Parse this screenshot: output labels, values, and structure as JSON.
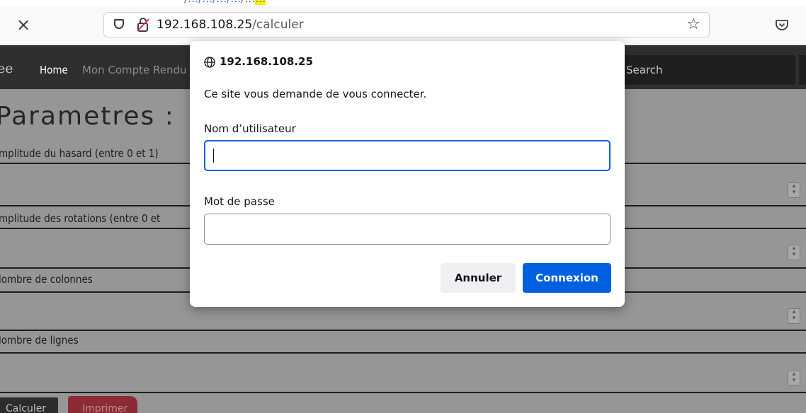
{
  "browser": {
    "url_host": "192.168.108.25",
    "url_path": "/calculer",
    "top_strip_text": "/…/…/…/…/…",
    "top_strip_highlight": "…"
  },
  "page": {
    "brand": "ee",
    "nav": {
      "home": "Home",
      "compte": "Mon Compte Rendu",
      "search_placeholder": "Search"
    },
    "title": "Parametres :",
    "fields": [
      {
        "label": "mplitude du hasard (entre 0 et 1)"
      },
      {
        "label": "mplitude des rotations (entre 0 et"
      },
      {
        "label": "lombre de colonnes"
      },
      {
        "label": "lombre de lignes"
      }
    ],
    "buttons": {
      "calculer": "Calculer",
      "imprimer": "Imprimer"
    }
  },
  "dialog": {
    "host": "192.168.108.25",
    "message": "Ce site vous demande de vous connecter.",
    "username_label": "Nom d’utilisateur",
    "username_value": "",
    "password_label": "Mot de passe",
    "password_value": "",
    "cancel_label": "Annuler",
    "connect_label": "Connexion"
  },
  "colors": {
    "accent": "#0061e0",
    "print_button": "#8c2a35",
    "navbar": "#2f2f31"
  }
}
